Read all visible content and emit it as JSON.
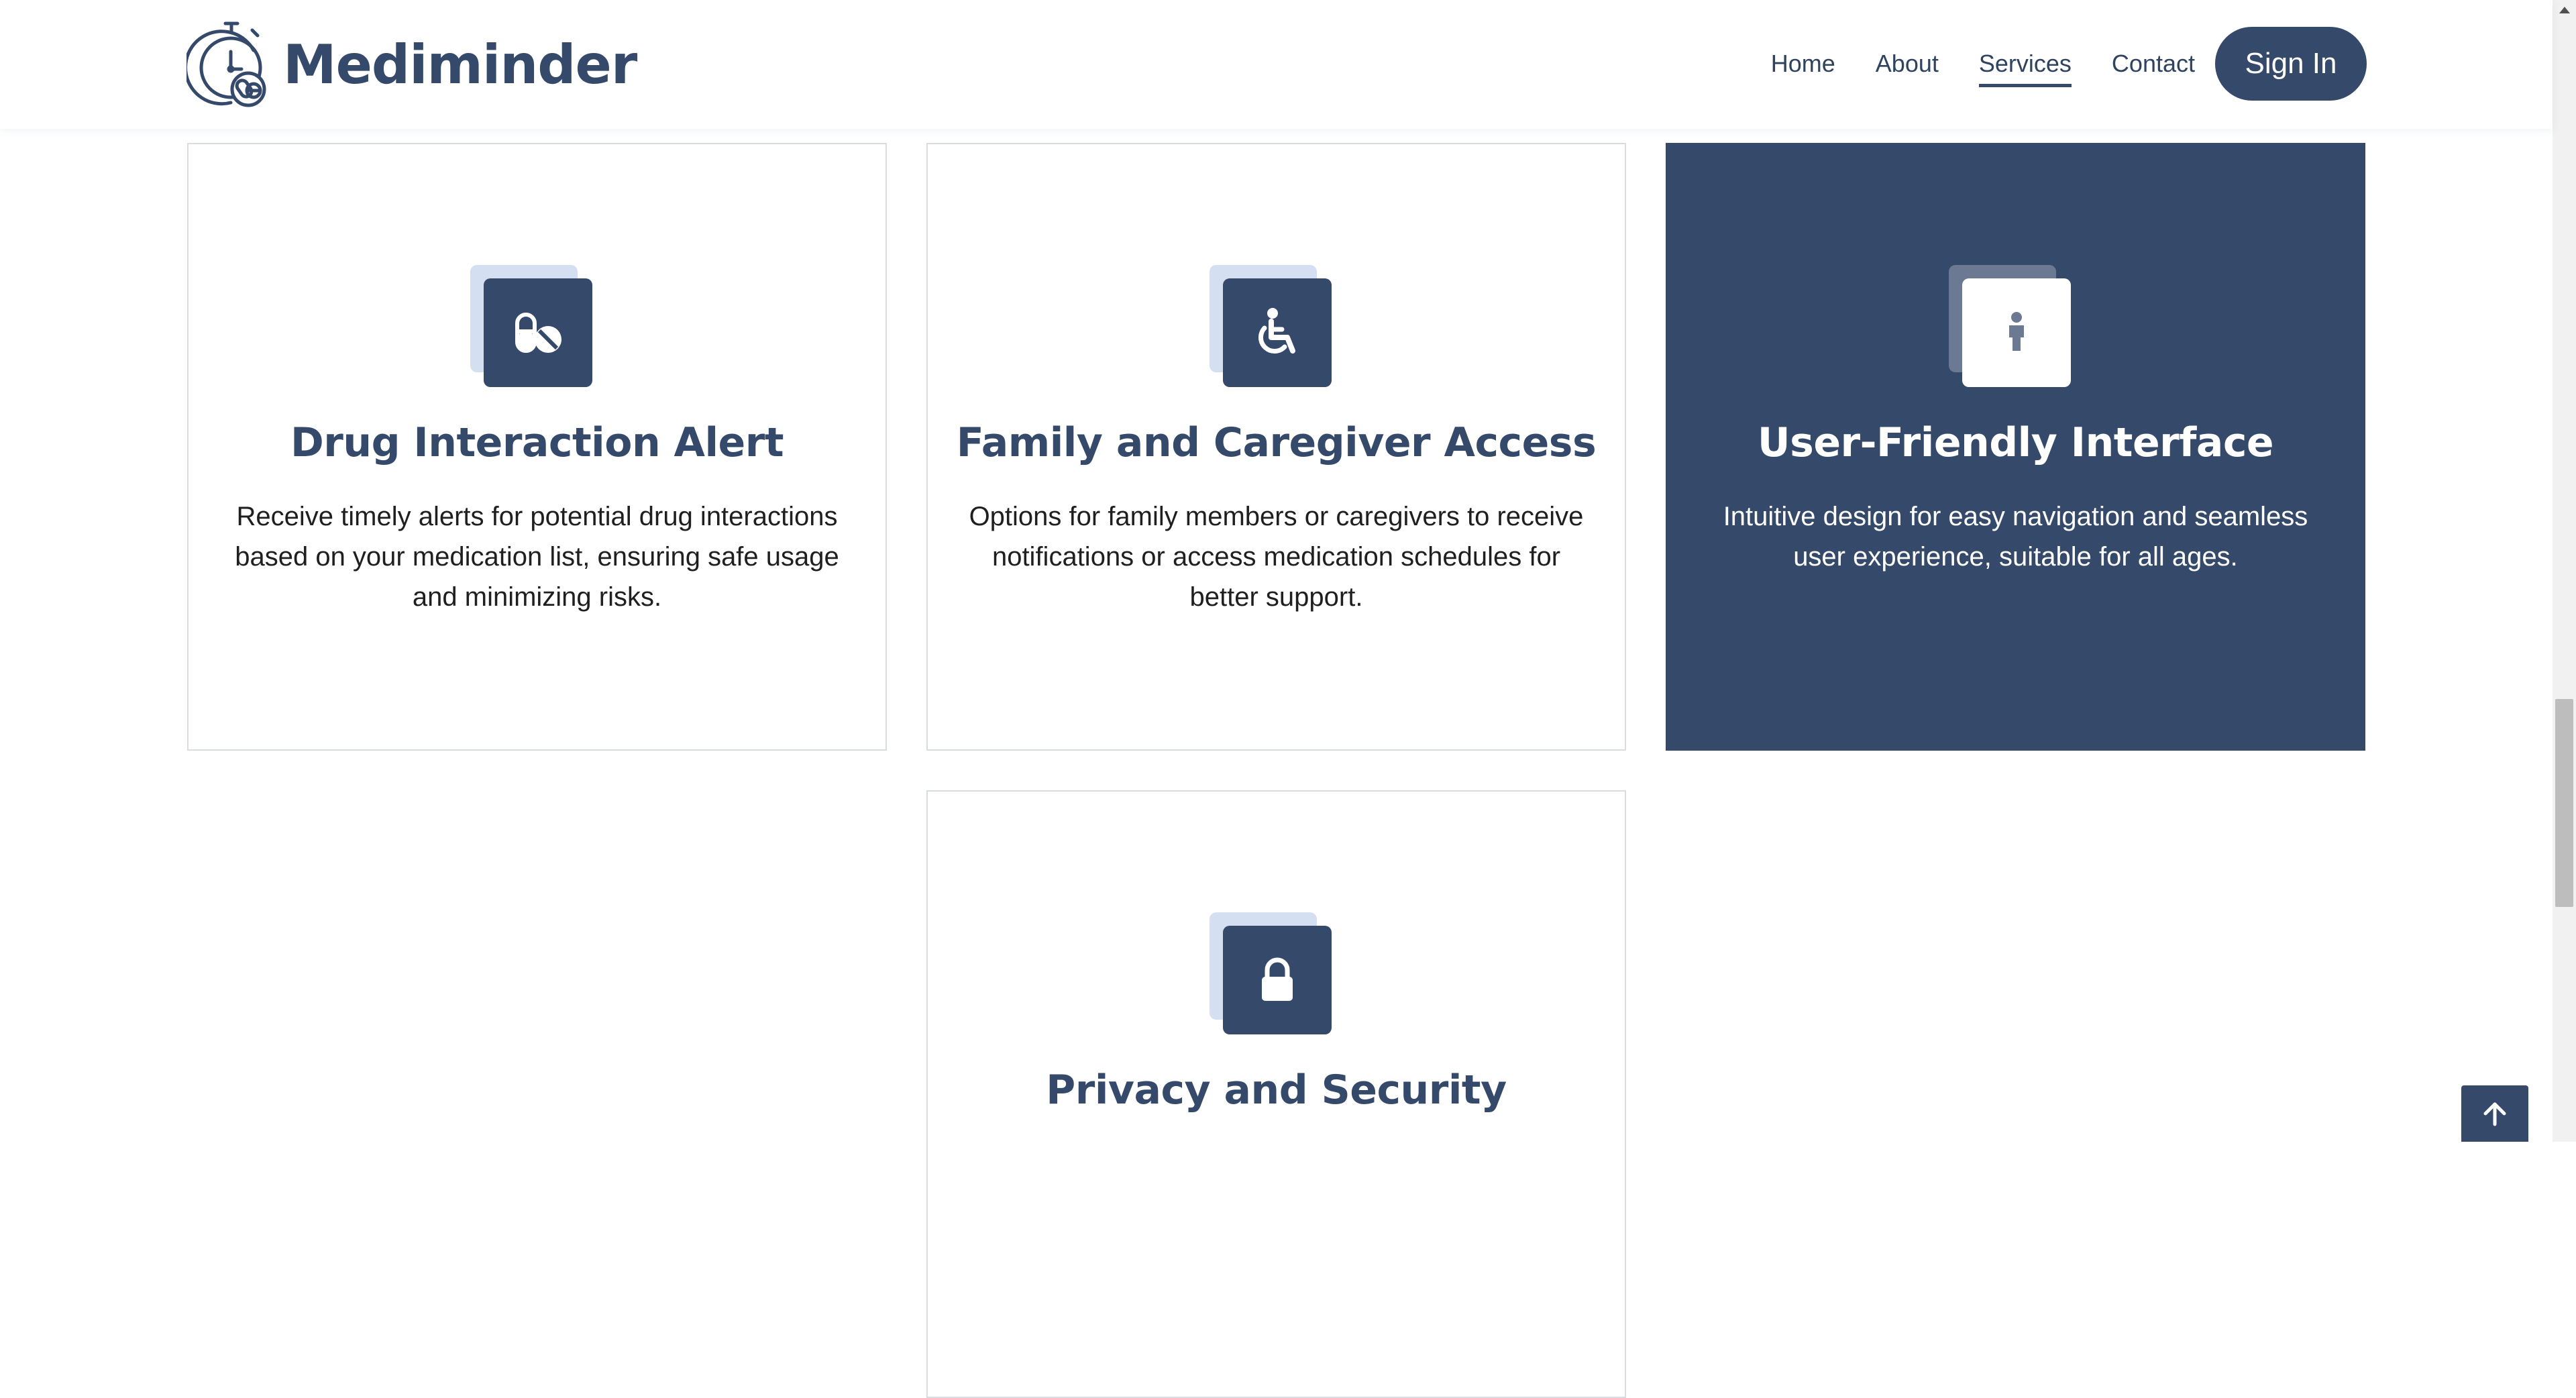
{
  "brand": {
    "name": "Mediminder",
    "logo_icon": "stopwatch-pill-icon"
  },
  "nav": {
    "items": [
      {
        "label": "Home",
        "active": false
      },
      {
        "label": "About",
        "active": false
      },
      {
        "label": "Services",
        "active": true
      },
      {
        "label": "Contact",
        "active": false
      }
    ],
    "signin_label": "Sign In"
  },
  "services": [
    {
      "title": "Drug Interaction Alert",
      "description": "Receive timely alerts for potential drug interactions based on your medication list, ensuring safe usage and minimizing risks.",
      "icon": "pills-icon",
      "highlighted": false
    },
    {
      "title": "Family and Caregiver Access",
      "description": "Options for family members or caregivers to receive notifications or access medication schedules for better support.",
      "icon": "wheelchair-icon",
      "highlighted": false
    },
    {
      "title": "User-Friendly Interface",
      "description": "Intuitive design for easy navigation and seamless user experience, suitable for all ages.",
      "icon": "person-icon",
      "highlighted": true
    },
    {
      "title": "Privacy and Security",
      "description": "",
      "icon": "lock-icon",
      "highlighted": false
    }
  ],
  "colors": {
    "primary": "#35496a",
    "icon_accent_light": "#d4e0f1",
    "icon_accent_dark": "#6b7a92",
    "card_border": "#d9dde3",
    "text": "#1f1f1f",
    "white": "#ffffff"
  },
  "back_to_top_icon": "arrow-up-icon"
}
